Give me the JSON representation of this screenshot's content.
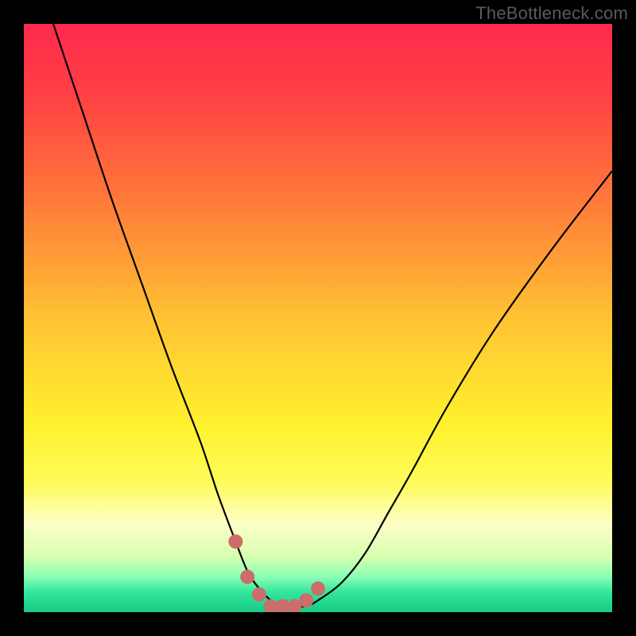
{
  "watermark": "TheBottleneck.com",
  "colors": {
    "frame": "#000000",
    "watermark": "#5a5a5a",
    "curve": "#000000",
    "markers": "#cc6d6b",
    "gradient_stops": [
      {
        "offset": 0.0,
        "color": "#ff2a4d"
      },
      {
        "offset": 0.12,
        "color": "#ff4044"
      },
      {
        "offset": 0.3,
        "color": "#ff7a3a"
      },
      {
        "offset": 0.5,
        "color": "#ffc233"
      },
      {
        "offset": 0.68,
        "color": "#fff12e"
      },
      {
        "offset": 0.78,
        "color": "#fffb5a"
      },
      {
        "offset": 0.85,
        "color": "#fcffc8"
      },
      {
        "offset": 0.905,
        "color": "#d8ffb0"
      },
      {
        "offset": 0.94,
        "color": "#8affb5"
      },
      {
        "offset": 0.965,
        "color": "#35e79d"
      },
      {
        "offset": 1.0,
        "color": "#18c884"
      }
    ]
  },
  "chart_data": {
    "type": "line",
    "title": "",
    "xlabel": "",
    "ylabel": "",
    "xlim": [
      0,
      100
    ],
    "ylim": [
      0,
      100
    ],
    "grid": false,
    "series": [
      {
        "name": "bottleneck-curve",
        "x": [
          5,
          10,
          15,
          20,
          25,
          30,
          33,
          36,
          38,
          40,
          42,
          44,
          46,
          48,
          50,
          54,
          58,
          62,
          66,
          72,
          80,
          90,
          100
        ],
        "values": [
          100,
          85,
          70,
          56,
          42,
          29,
          20,
          12,
          7,
          4,
          2,
          1,
          1,
          1,
          2,
          5,
          10,
          17,
          24,
          35,
          48,
          62,
          75
        ]
      }
    ],
    "markers": {
      "name": "highlight-points",
      "x": [
        36,
        38,
        40,
        42,
        44,
        46,
        48,
        50
      ],
      "values": [
        12,
        6,
        3,
        1,
        1,
        1,
        2,
        4
      ]
    }
  }
}
